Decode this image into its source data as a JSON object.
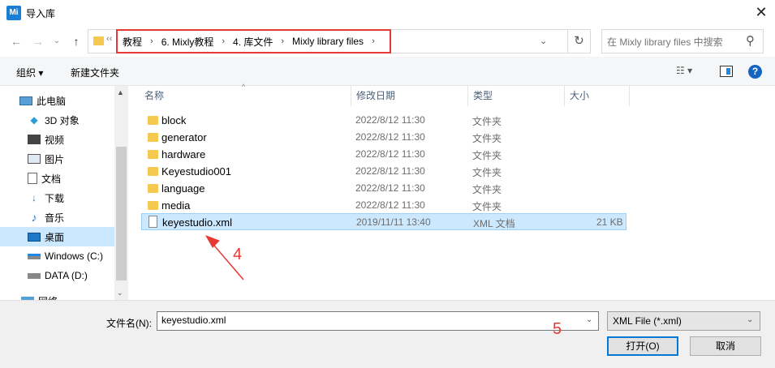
{
  "window": {
    "title": "导入库",
    "app_icon_text": "Mi",
    "close": "✕"
  },
  "nav": {
    "back": "←",
    "forward": "→",
    "recent": "⌄",
    "up": "↑",
    "overflow": "‹‹",
    "breadcrumbs": [
      "教程",
      "6. Mixly教程",
      "4. 库文件",
      "Mixly library files"
    ],
    "separator": "›",
    "dropdown": "⌄",
    "refresh": "↻",
    "search_placeholder": "在 Mixly library files 中搜索",
    "search_icon": "⚲"
  },
  "toolbar": {
    "organize": "组织 ▾",
    "new_folder": "新建文件夹",
    "view": "☷ ▾",
    "help": "?"
  },
  "sidebar": {
    "items": [
      {
        "label": "此电脑",
        "icon": "computer-icon"
      },
      {
        "label": "3D 对象",
        "icon": "cube-icon"
      },
      {
        "label": "视频",
        "icon": "video-icon"
      },
      {
        "label": "图片",
        "icon": "picture-icon"
      },
      {
        "label": "文档",
        "icon": "document-icon"
      },
      {
        "label": "下载",
        "icon": "download-icon"
      },
      {
        "label": "音乐",
        "icon": "music-icon"
      },
      {
        "label": "桌面",
        "icon": "desktop-icon",
        "selected": true
      },
      {
        "label": "Windows (C:)",
        "icon": "drive-icon"
      },
      {
        "label": "DATA (D:)",
        "icon": "drive-icon"
      },
      {
        "label": "网络",
        "icon": "network-icon"
      }
    ],
    "scroll_up": "▲",
    "scroll_down": "⌄"
  },
  "columns": {
    "name": "名称",
    "date": "修改日期",
    "type": "类型",
    "size": "大小",
    "sort_caret": "^"
  },
  "rows": [
    {
      "name": "block",
      "date": "2022/8/12 11:30",
      "type": "文件夹",
      "size": "",
      "kind": "folder"
    },
    {
      "name": "generator",
      "date": "2022/8/12 11:30",
      "type": "文件夹",
      "size": "",
      "kind": "folder"
    },
    {
      "name": "hardware",
      "date": "2022/8/12 11:30",
      "type": "文件夹",
      "size": "",
      "kind": "folder"
    },
    {
      "name": "Keyestudio001",
      "date": "2022/8/12 11:30",
      "type": "文件夹",
      "size": "",
      "kind": "folder"
    },
    {
      "name": "language",
      "date": "2022/8/12 11:30",
      "type": "文件夹",
      "size": "",
      "kind": "folder"
    },
    {
      "name": "media",
      "date": "2022/8/12 11:30",
      "type": "文件夹",
      "size": "",
      "kind": "folder"
    },
    {
      "name": "keyestudio.xml",
      "date": "2019/11/11 13:40",
      "type": "XML 文档",
      "size": "21 KB",
      "kind": "file",
      "selected": true
    }
  ],
  "annotations": {
    "step4": "4",
    "step5": "5",
    "color": "#e53935"
  },
  "bottom": {
    "filename_label": "文件名(N):",
    "filename_value": "keyestudio.xml",
    "filetype_value": "XML File (*.xml)",
    "dropdown": "⌄",
    "open_label": "打开(O)",
    "cancel_label": "取消"
  }
}
